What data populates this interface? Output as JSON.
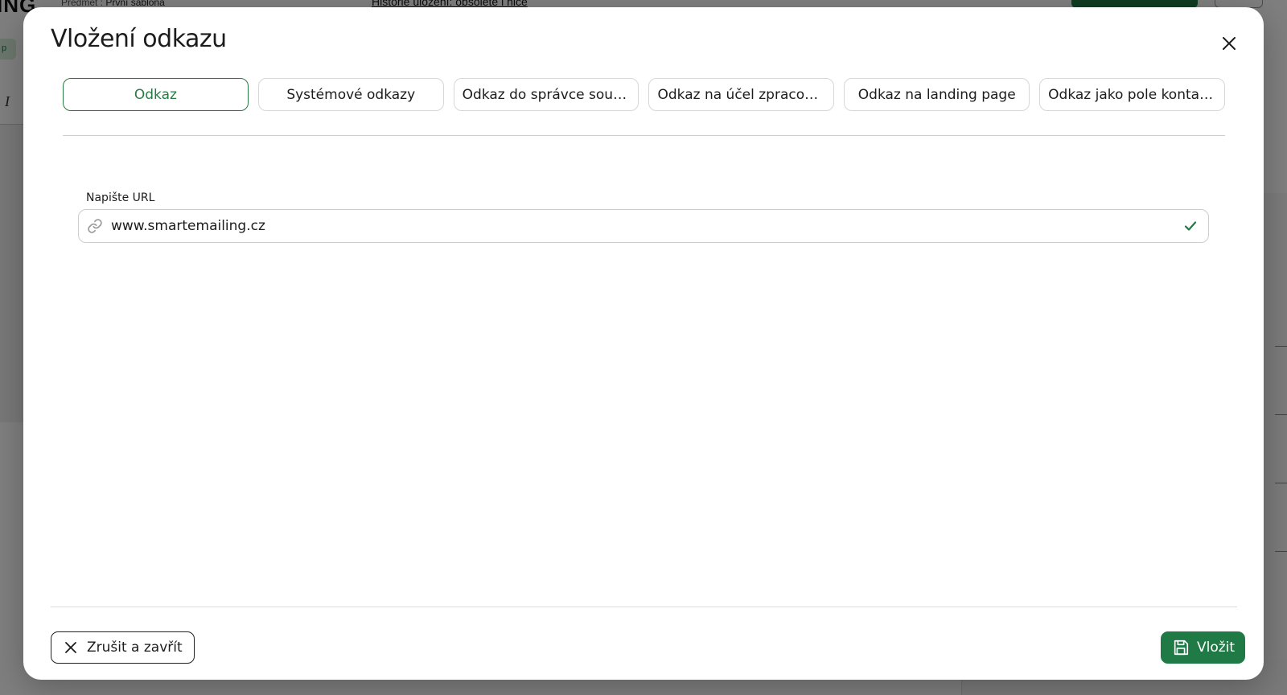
{
  "background": {
    "logo_text": "ING",
    "subject_prefix": "Předmět :",
    "subject_value": "První šablona",
    "history_link": "Historie uložení: obsolete i nice"
  },
  "modal": {
    "title": "Vložení odkazu",
    "close_icon": "close-icon",
    "tabs": [
      {
        "label": "Odkaz",
        "active": true
      },
      {
        "label": "Systémové odkazy",
        "active": false
      },
      {
        "label": "Odkaz do správce souborů",
        "active": false
      },
      {
        "label": "Odkaz na účel zpracování",
        "active": false
      },
      {
        "label": "Odkaz na landing page",
        "active": false
      },
      {
        "label": "Odkaz jako pole kontaktu",
        "active": false
      }
    ],
    "url_field": {
      "label": "Napište URL",
      "value": "www.smartemailing.cz",
      "leading_icon": "link-icon",
      "trailing_icon": "check-icon"
    },
    "footer": {
      "cancel_label": "Zrušit a zavřít",
      "insert_label": "Vložit"
    }
  },
  "colors": {
    "accent": "#1f7a45",
    "accent_text": "#2a7a45",
    "overlay": "rgba(0,0,0,0.5)",
    "border": "#d7d7d7"
  }
}
